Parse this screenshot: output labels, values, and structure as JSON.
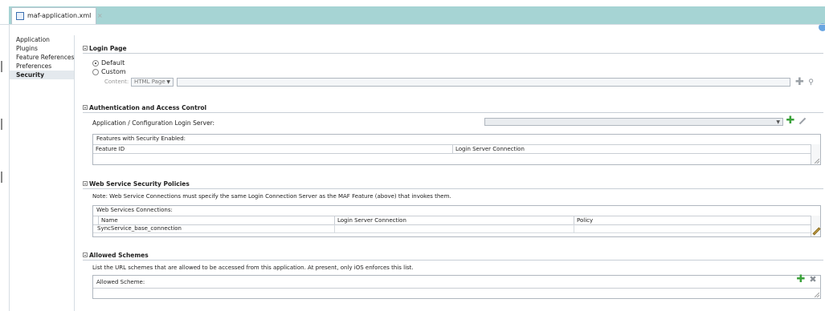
{
  "editor_tab": {
    "label": "maf-application.xml",
    "close": "×"
  },
  "nav": {
    "items": [
      {
        "label": "Application"
      },
      {
        "label": "Plugins"
      },
      {
        "label": "Feature References"
      },
      {
        "label": "Preferences"
      },
      {
        "label": "Security",
        "selected": true
      }
    ]
  },
  "login_page": {
    "title": "Login Page",
    "default_label": "Default",
    "custom_label": "Custom",
    "selected": "Default",
    "content_label": "Content:",
    "content_type": "HTML Page",
    "content_value": ""
  },
  "auth": {
    "title": "Authentication and Access Control",
    "login_server_label": "Application / Configuration Login Server:",
    "login_server_value": "",
    "features_caption": "Features with Security Enabled:",
    "features_columns": [
      "Feature ID",
      "Login Server Connection"
    ],
    "features_rows": []
  },
  "ws": {
    "title": "Web Service Security Policies",
    "note": "Note: Web Service Connections must specify the same Login Connection Server as the MAF Feature (above) that invokes them.",
    "caption": "Web Services Connections:",
    "columns": [
      "Name",
      "Login Server Connection",
      "Policy"
    ],
    "rows": [
      {
        "name": "SyncService_base_connection",
        "login_server_connection": "",
        "policy": ""
      }
    ]
  },
  "schemes": {
    "title": "Allowed Schemes",
    "description": "List the URL schemes that are allowed to be accessed from this application.  At present, only iOS enforces this list.",
    "caption": "Allowed Scheme:",
    "rows": []
  },
  "colors": {
    "tab_strip": "#a6d4d4",
    "add_green": "#3aa13a",
    "selected_nav": "#e4e9ee"
  },
  "icons": [
    "file-xml-icon",
    "close-icon",
    "help-icon",
    "add-icon",
    "search-icon",
    "edit-icon",
    "delete-icon",
    "resize-grip-icon"
  ]
}
